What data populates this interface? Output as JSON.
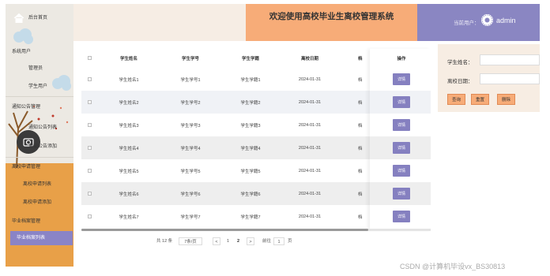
{
  "header": {
    "title": "欢迎使用高校毕业生离校管理系统",
    "user_label": "当前用户：",
    "user_name": "admin"
  },
  "sidebar": {
    "home": "后台首页",
    "groups": [
      {
        "label": "系统用户",
        "items": [
          "管理员",
          "学生用户"
        ]
      },
      {
        "label": "通知公告管理",
        "items": [
          "通知公告列表",
          "通知公告添加"
        ]
      },
      {
        "label": "离校申请管理",
        "items": [
          "离校申请列表",
          "离校申请添加"
        ]
      },
      {
        "label": "毕业档案管理",
        "items": [
          "毕业档案列表"
        ]
      }
    ],
    "active_item": "毕业档案列表"
  },
  "table": {
    "columns": [
      "学生姓名",
      "学生学号",
      "学生学籍",
      "离校日期",
      "档",
      "操作"
    ],
    "rows": [
      [
        "学生姓名1",
        "学生学号1",
        "学生学籍1",
        "2024-01-31",
        "档"
      ],
      [
        "学生姓名2",
        "学生学号2",
        "学生学籍2",
        "2024-01-31",
        "档"
      ],
      [
        "学生姓名3",
        "学生学号3",
        "学生学籍3",
        "2024-01-31",
        "档"
      ],
      [
        "学生姓名4",
        "学生学号4",
        "学生学籍4",
        "2024-01-31",
        "档"
      ],
      [
        "学生姓名5",
        "学生学号5",
        "学生学籍5",
        "2024-01-31",
        "档"
      ],
      [
        "学生姓名6",
        "学生学号6",
        "学生学籍6",
        "2024-01-31",
        "档"
      ],
      [
        "学生姓名7",
        "学生学号7",
        "学生学籍7",
        "2024-01-31",
        "档"
      ]
    ],
    "action_label": "详情"
  },
  "pagination": {
    "total": "共 12 条",
    "page_size": "7条/页",
    "prev": "<",
    "pages": [
      "1",
      "2"
    ],
    "current_page": "2",
    "next": ">",
    "goto_label": "前往",
    "goto_value": "1",
    "page_unit": "页"
  },
  "search": {
    "name_label": "学生姓名：",
    "date_label": "离校日期：",
    "name_value": "",
    "date_value": "",
    "query_label": "查询",
    "reset_label": "重置",
    "delete_label": "删除"
  },
  "watermark": "CSDN @计算机毕设vx_BS30813",
  "colors": {
    "accent_purple": "#8a86c2",
    "accent_orange": "#f7ac78",
    "sidebar_bg": "#ece9e3",
    "sidebar_lower": "#e8a048"
  },
  "icons": {
    "home": "home-icon",
    "avatar": "avatar-icon",
    "camera": "camera-icon"
  }
}
